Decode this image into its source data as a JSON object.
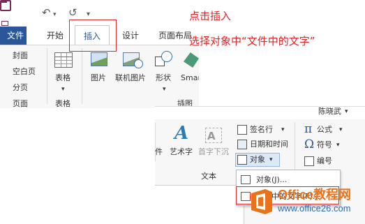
{
  "annotations": {
    "step1": "点击插入",
    "step2": "选择对象中“文件中的文字”"
  },
  "quick_access": {
    "undo_glyph": "↶",
    "redo_glyph": "↺",
    "more_glyph": "▾",
    "icons": [
      "save-icon",
      "undo-icon",
      "redo-icon",
      "customize-qat-icon"
    ]
  },
  "tabs": {
    "file": "文件",
    "home": "开始",
    "insert": "插入",
    "design": "设计",
    "layout": "页面布局"
  },
  "ribbon_top": {
    "pages": {
      "cover": "封面",
      "blank": "空白页",
      "break": "分页",
      "group": "页面"
    },
    "tables": {
      "table": "表格",
      "arrow": "▾",
      "group": "表格"
    },
    "illustrations": {
      "pictures": "图片",
      "online_pictures": "联机图片",
      "shapes": "形状",
      "shapes_arrow": "▾",
      "smartart": "Smar",
      "group": "插图"
    }
  },
  "ribbon_bottom": {
    "user": "陈晓武",
    "user_arrow": "▾",
    "text_group": {
      "textbox_partial": "件",
      "wordart": "艺术字",
      "dropcap": "首字下沉",
      "signature_line": "签名行",
      "signature_arrow": "▾",
      "date_time": "日期和时间",
      "object": "对象",
      "object_arrow": "▾",
      "group": "文本"
    },
    "symbols_group": {
      "equation": "公式",
      "equation_glyph": "π",
      "equation_arrow": "▾",
      "symbol": "符号",
      "symbol_glyph": "Ω",
      "symbol_arrow": "▾",
      "number": "编号"
    }
  },
  "object_menu": {
    "items": [
      {
        "label": "对象(J)..."
      },
      {
        "label": "文件中的文字(F)..."
      }
    ]
  },
  "watermark": {
    "name": "Office教程网",
    "url": "www.office26.com"
  },
  "colors": {
    "accent_blue": "#2b579a",
    "annotation_red": "#e0262a",
    "watermark_orange": "#e8731b"
  }
}
